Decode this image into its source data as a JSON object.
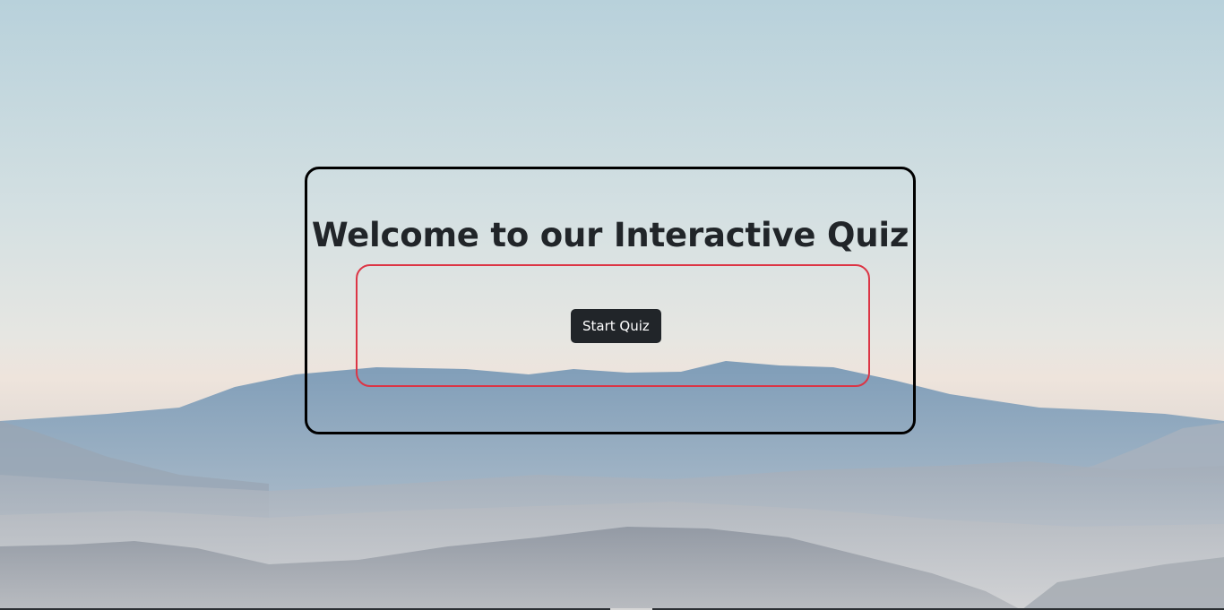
{
  "page": {
    "title": "Welcome to our Interactive Quiz",
    "start_button_label": "Start Quiz"
  },
  "colors": {
    "card_border": "#000000",
    "inner_border": "#dc3545",
    "button_bg": "#212529",
    "button_text": "#ffffff",
    "title_text": "#212529"
  },
  "background": {
    "description_icon": "mountain-landscape-image"
  }
}
